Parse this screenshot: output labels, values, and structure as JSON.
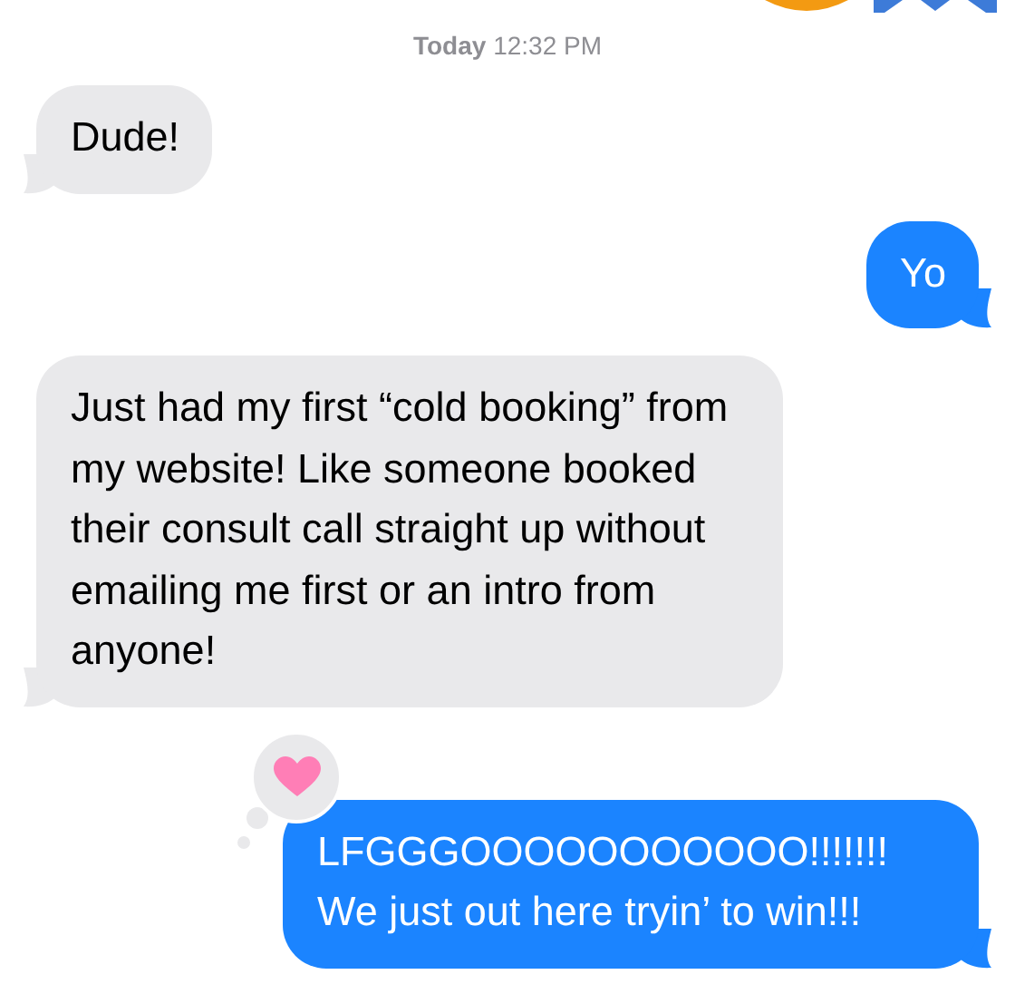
{
  "timestamp": {
    "day": "Today",
    "time": "12:32 PM"
  },
  "messages": [
    {
      "kind": "received",
      "text": "Dude!",
      "reacted": false
    },
    {
      "kind": "sent",
      "text": "Yo",
      "reacted": false
    },
    {
      "kind": "received",
      "text": "Just had my first “cold booking” from my website! Like someone booked their consult call straight up without emailing me first or an intro from anyone!",
      "reacted": false
    },
    {
      "kind": "sent",
      "text": "LFGGGOOOOOOOOOOO!!!!!!! We just out here tryin’ to win!!!",
      "reacted": true
    }
  ]
}
